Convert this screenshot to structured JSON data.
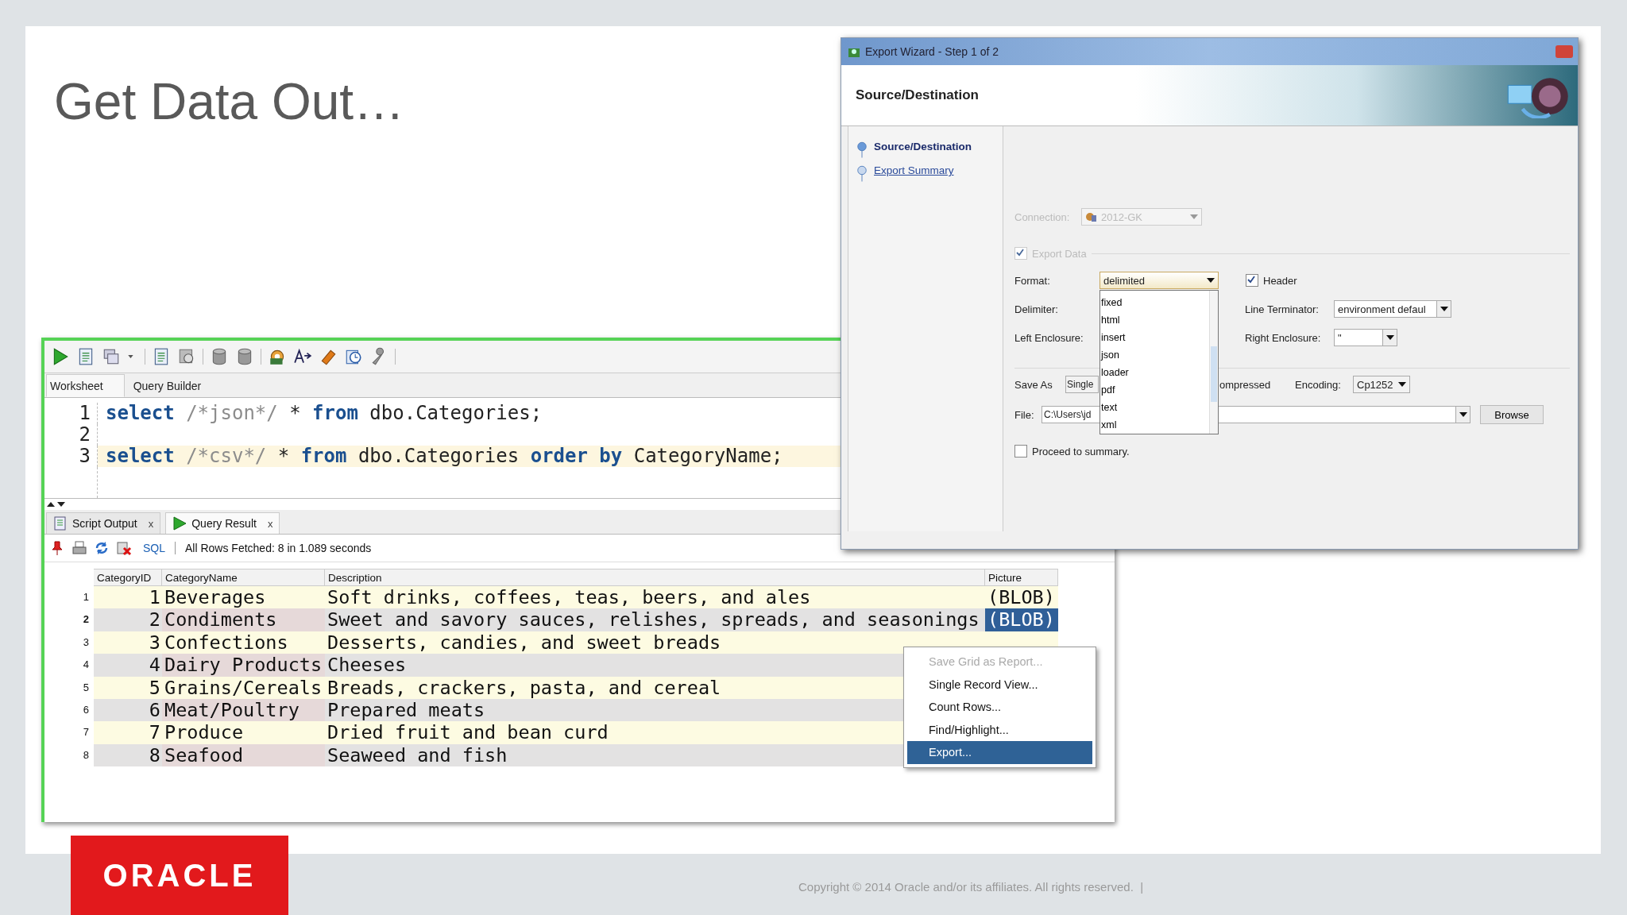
{
  "slide": {
    "title": "Get Data Out…",
    "copyright": "Copyright © 2014 Oracle and/or its affiliates. All rights reserved.  |",
    "logo": "ORACLE"
  },
  "worksheet": {
    "tabs": [
      {
        "label": "Worksheet",
        "selected": true
      },
      {
        "label": "Query Builder",
        "selected": false
      }
    ],
    "lines": [
      {
        "number": "1",
        "current": false,
        "tokens": [
          {
            "kind": "keyword",
            "text": "select"
          },
          {
            "kind": "comment",
            "text": " /*json*/ "
          },
          {
            "kind": "plain",
            "text": "* "
          },
          {
            "kind": "keyword",
            "text": "from"
          },
          {
            "kind": "plain",
            "text": " dbo.Categories;"
          }
        ]
      },
      {
        "number": "2",
        "current": false
      },
      {
        "number": "3",
        "current": true,
        "tokens": [
          {
            "kind": "keyword",
            "text": "select"
          },
          {
            "kind": "comment",
            "text": " /*csv*/ "
          },
          {
            "kind": "plain",
            "text": "* "
          },
          {
            "kind": "keyword",
            "text": "from"
          },
          {
            "kind": "plain",
            "text": " dbo.Categories "
          },
          {
            "kind": "keyword",
            "text": "order by"
          },
          {
            "kind": "plain",
            "text": " CategoryName;"
          }
        ]
      }
    ]
  },
  "output_tabs": [
    {
      "kind": "script",
      "label": "Script Output",
      "close": "x",
      "selected": false
    },
    {
      "kind": "result",
      "label": "Query Result",
      "close": "x",
      "selected": true
    }
  ],
  "result_toolbar": {
    "link": "SQL",
    "status": "All Rows Fetched: 8 in 1.089 seconds"
  },
  "grid": {
    "columns": [
      "CategoryID",
      "CategoryName",
      "Description",
      "Picture"
    ],
    "rows": [
      {
        "number": "1",
        "selected": false,
        "cells": [
          "1",
          "Beverages",
          "Soft drinks, coffees, teas, beers, and ales",
          "(BLOB)"
        ]
      },
      {
        "number": "2",
        "selected": true,
        "cells": [
          "2",
          "Condiments",
          "Sweet and savory sauces, relishes, spreads, and seasonings",
          "(BLOB)"
        ]
      },
      {
        "number": "3",
        "selected": false,
        "cells": [
          "3",
          "Confections",
          "Desserts, candies, and sweet breads"
        ]
      },
      {
        "number": "4",
        "selected": false,
        "cells": [
          "4",
          "Dairy Products",
          "Cheeses"
        ]
      },
      {
        "number": "5",
        "selected": false,
        "cells": [
          "5",
          "Grains/Cereals",
          "Breads, crackers, pasta, and cereal"
        ]
      },
      {
        "number": "6",
        "selected": false,
        "cells": [
          "6",
          "Meat/Poultry",
          "Prepared meats"
        ]
      },
      {
        "number": "7",
        "selected": false,
        "cells": [
          "7",
          "Produce",
          "Dried fruit and bean curd"
        ]
      },
      {
        "number": "8",
        "selected": false,
        "cells": [
          "8",
          "Seafood",
          "Seaweed and fish"
        ]
      }
    ]
  },
  "context_menu": [
    {
      "label": "Save Grid as Report...",
      "disabled": true,
      "selected": false
    },
    {
      "label": "Single Record View...",
      "disabled": false,
      "selected": false
    },
    {
      "label": "Count Rows...",
      "disabled": false,
      "selected": false
    },
    {
      "label": "Find/Highlight...",
      "disabled": false,
      "selected": false
    },
    {
      "label": "Export...",
      "disabled": false,
      "selected": true
    }
  ],
  "wizard": {
    "title": "Export Wizard - Step 1 of 2",
    "heading": "Source/Destination",
    "steps": [
      {
        "label": "Source/Destination",
        "selected": true
      },
      {
        "label": "Export Summary",
        "selected": false
      }
    ],
    "connection": {
      "label": "Connection:",
      "value": "2012-GK",
      "disabled": true
    },
    "export_data": {
      "label": "Export Data",
      "checked": true,
      "disabled": true
    },
    "format": {
      "label": "Format:",
      "value": "delimited",
      "options": [
        "fixed",
        "html",
        "insert",
        "json",
        "loader",
        "pdf",
        "text",
        "xml"
      ]
    },
    "header": {
      "label": "Header",
      "checked": true
    },
    "delimiter": {
      "label": "Delimiter:"
    },
    "line_terminator": {
      "label": "Line Terminator:",
      "value": "environment defaul"
    },
    "left_enclosure": {
      "label": "Left Enclosure:"
    },
    "right_enclosure": {
      "label": "Right Enclosure:",
      "value": "\""
    },
    "save_as": {
      "label": "Save As",
      "value": "Single"
    },
    "compressed": {
      "label": "ompressed"
    },
    "encoding": {
      "label": "Encoding:",
      "value": "Cp1252"
    },
    "file": {
      "label": "File:",
      "value": "C:\\Users\\jd"
    },
    "browse": "Browse",
    "proceed": {
      "label": "Proceed to summary.",
      "checked": false
    }
  }
}
